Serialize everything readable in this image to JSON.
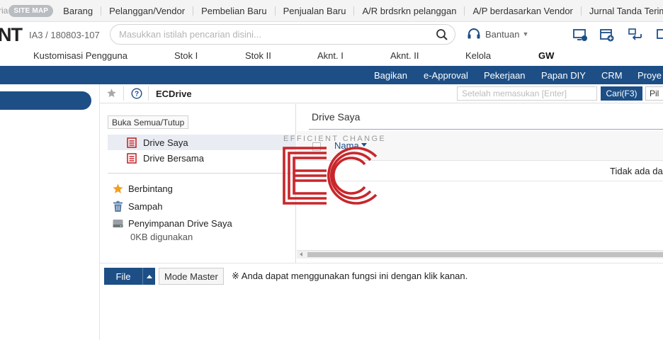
{
  "topbar": {
    "cut_text": "ria",
    "sitemap_label": "SITE MAP",
    "links": [
      "Barang",
      "Pelanggan/Vendor",
      "Pembelian Baru",
      "Penjualan Baru",
      "A/R brdsrkn pelanggan",
      "A/P berdasarkan Vendor",
      "Jurnal Tanda Terim"
    ]
  },
  "header": {
    "logo_text": "NT",
    "company_code": "IA3 / 180803-107",
    "search_placeholder": "Masukkan istilah pencarian disini...",
    "help_label": "Bantuan"
  },
  "modules": [
    "Kustomisasi Pengguna",
    "Stok I",
    "Stok II",
    "Aknt. I",
    "Aknt. II",
    "Kelola",
    "GW"
  ],
  "active_module": "GW",
  "submenu": [
    "Bagikan",
    "e-Approval",
    "Pekerjaan",
    "Papan DIY",
    "CRM",
    "Proye"
  ],
  "page": {
    "title": "ECDrive",
    "search_placeholder": "Setelah memasukan [Enter]",
    "find_label": "Cari(F3)",
    "options_label": "Pil"
  },
  "tree": {
    "toggle_label": "Buka Semua/Tutup",
    "folders": [
      {
        "label": "Drive Saya",
        "selected": true
      },
      {
        "label": "Drive Bersama",
        "selected": false
      }
    ],
    "starred_label": "Berbintang",
    "trash_label": "Sampah",
    "storage_label": "Penyimpanan Drive Saya",
    "storage_usage": "0KB digunakan"
  },
  "content": {
    "title": "Drive Saya",
    "column_name": "Nama",
    "empty_text": "Tidak ada da"
  },
  "actions": {
    "file_label": "File",
    "master_label": "Mode Master",
    "hint": "※ Anda dapat menggunakan fungsi ini dengan klik kanan."
  },
  "watermark": {
    "text": "EFFICIENT CHANGE",
    "color": "#c8262b"
  },
  "colors": {
    "primary": "#1d4f86",
    "folder_icon": "#c8262b",
    "star": "#f0a020"
  }
}
